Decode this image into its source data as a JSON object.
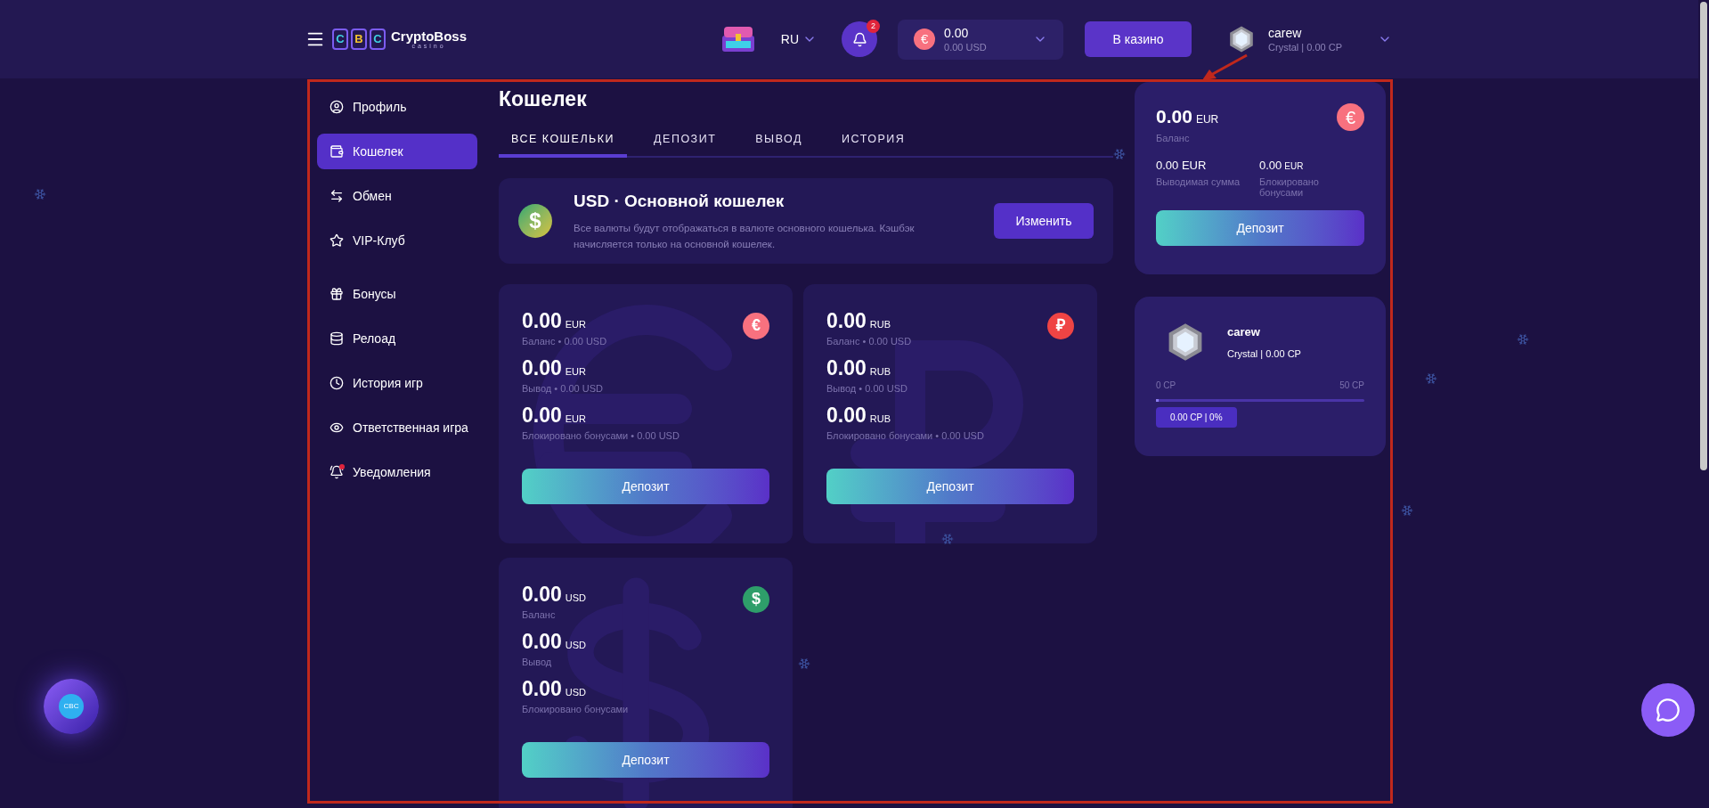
{
  "header": {
    "brand": {
      "letters": [
        {
          "char": "C",
          "color": "#3fd0e0"
        },
        {
          "char": "B",
          "color": "#f2c230"
        },
        {
          "char": "C",
          "color": "#3fd0e0"
        }
      ],
      "name": "CryptoBoss",
      "sub": "casino"
    },
    "language": "RU",
    "notifications": {
      "count": "2"
    },
    "balance": {
      "symbol": "€",
      "amount": "0.00",
      "usd": "0.00 USD"
    },
    "casino_button": "В казино",
    "user": {
      "name": "carew",
      "status_line": "Crystal | 0.00 CP"
    }
  },
  "sidebar": {
    "groups": [
      [
        {
          "label": "Профиль",
          "selected": false,
          "alert": false
        },
        {
          "label": "Кошелек",
          "selected": true,
          "alert": false
        },
        {
          "label": "Обмен",
          "selected": false,
          "alert": false
        },
        {
          "label": "VIP-Клуб",
          "selected": false,
          "alert": false
        }
      ],
      [
        {
          "label": "Бонусы",
          "selected": false,
          "alert": false
        },
        {
          "label": "Релоад",
          "selected": false,
          "alert": false
        },
        {
          "label": "История игр",
          "selected": false,
          "alert": false
        },
        {
          "label": "Ответственная игра",
          "selected": false,
          "alert": false
        },
        {
          "label": "Уведомления",
          "selected": false,
          "alert": true
        }
      ]
    ]
  },
  "page_title": "Кошелек",
  "tabs": [
    {
      "label": "ВСЕ КОШЕЛЬКИ",
      "selected": true
    },
    {
      "label": "ДЕПОЗИТ",
      "selected": false
    },
    {
      "label": "ВЫВОД",
      "selected": false
    },
    {
      "label": "ИСТОРИЯ",
      "selected": false
    }
  ],
  "main_wallet": {
    "symbol": "$",
    "title": "USD · Основной кошелек",
    "description": "Все валюты будут отображаться в валюте основного кошелька. Кэшбэк начисляется только на основной кошелек.",
    "button": "Изменить"
  },
  "wallets": [
    {
      "symbol": "€",
      "color": "#f8717f",
      "kind": "eur",
      "rows": [
        {
          "amount": "0.00",
          "currency": "EUR",
          "label": "Баланс • 0.00 USD"
        },
        {
          "amount": "0.00",
          "currency": "EUR",
          "label": "Вывод • 0.00 USD"
        },
        {
          "amount": "0.00",
          "currency": "EUR",
          "label": "Блокировано бонусами • 0.00 USD"
        }
      ],
      "button": "Депозит"
    },
    {
      "symbol": "₽",
      "color": "#ef4444",
      "kind": "rub",
      "rows": [
        {
          "amount": "0.00",
          "currency": "RUB",
          "label": "Баланс • 0.00 USD"
        },
        {
          "amount": "0.00",
          "currency": "RUB",
          "label": "Вывод • 0.00 USD"
        },
        {
          "amount": "0.00",
          "currency": "RUB",
          "label": "Блокировано бонусами • 0.00 USD"
        }
      ],
      "button": "Депозит"
    },
    {
      "symbol": "$",
      "color": "#2e9e6a",
      "kind": "usd",
      "rows": [
        {
          "amount": "0.00",
          "currency": "USD",
          "label": "Баланс"
        },
        {
          "amount": "0.00",
          "currency": "USD",
          "label": "Вывод"
        },
        {
          "amount": "0.00",
          "currency": "USD",
          "label": "Блокировано бонусами"
        }
      ],
      "button": "Депозит"
    }
  ],
  "summary": {
    "amount": "0.00",
    "currency": "EUR",
    "label": "Баланс",
    "symbol": "€",
    "stats": [
      {
        "amount": "0.00 EUR",
        "label": "Выводимая сумма"
      },
      {
        "amount": "0.00",
        "currency": "EUR",
        "label": "Блокировано бонусами"
      }
    ],
    "button": "Депозит"
  },
  "level_card": {
    "name": "carew",
    "status_line": "Crystal | 0.00 CP",
    "min": "0 CP",
    "max": "50 CP",
    "level": 0,
    "progress_label": "0.00 CP | 0%"
  },
  "floating_badge": "CBC"
}
